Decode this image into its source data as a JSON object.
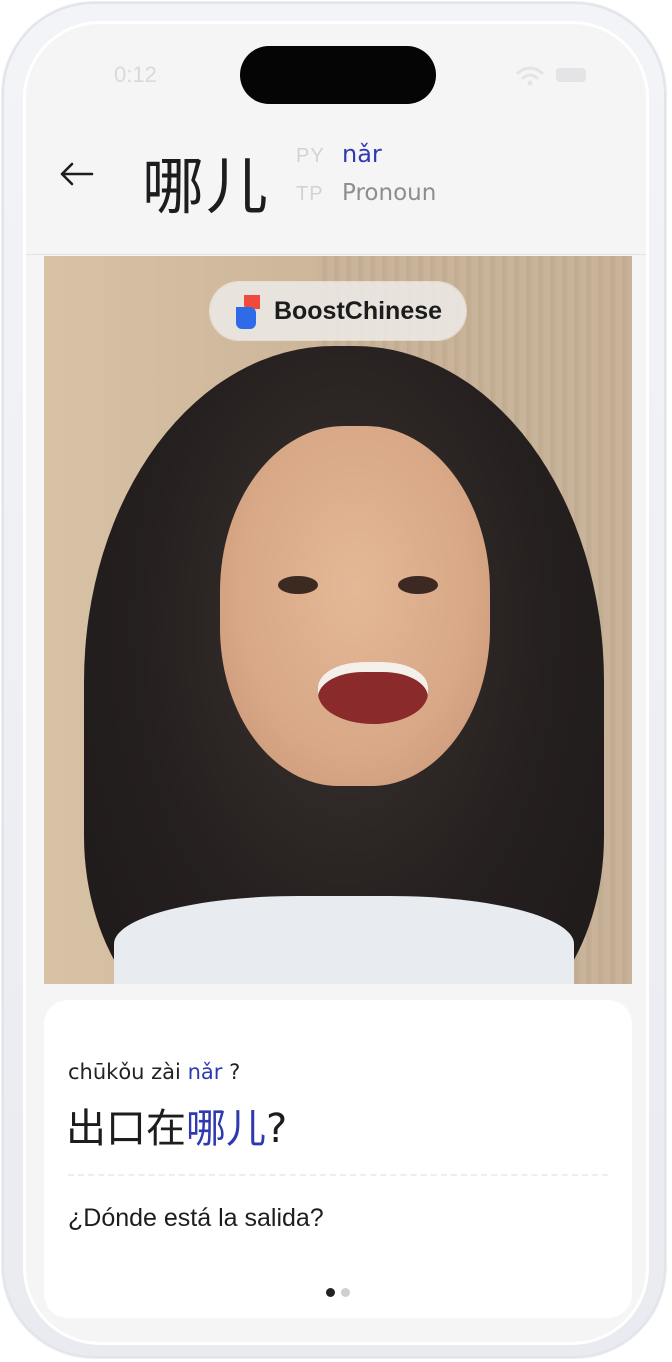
{
  "status_bar": {
    "time": "0:12"
  },
  "header": {
    "back_icon": "arrow-left-icon",
    "word": "哪儿",
    "pinyin_key": "PY",
    "pinyin_value": "nǎr",
    "type_key": "TP",
    "type_value": "Pronoun"
  },
  "video": {
    "brand_logo_icon": "boostchinese-logo-icon",
    "brand_name": "BoostChinese"
  },
  "example": {
    "pinyin_prefix": "chūkǒu zài",
    "pinyin_highlight": "nǎr",
    "pinyin_suffix": "?",
    "sentence_prefix": "出口在",
    "sentence_highlight": "哪儿",
    "sentence_suffix": "?",
    "translation": "¿Dónde está la salida?"
  },
  "pager": {
    "total": 2,
    "current": 1
  },
  "colors": {
    "accent": "#2f3ab0",
    "text": "#1d1d1f",
    "muted": "#8d8d92"
  }
}
